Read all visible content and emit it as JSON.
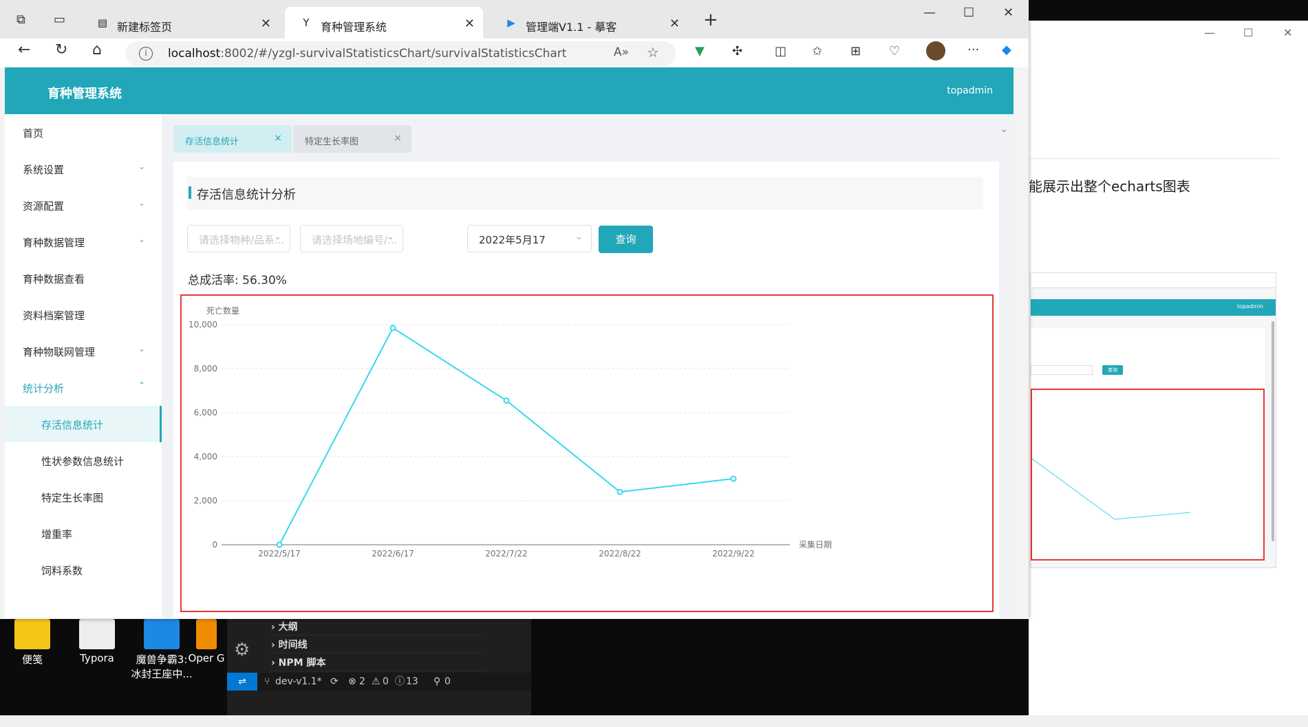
{
  "browser": {
    "tabs": [
      {
        "label": "新建标签页",
        "icon": "new-tab-page-icon"
      },
      {
        "label": "育种管理系统",
        "icon": "y-logo-icon",
        "active": true
      },
      {
        "label": "管理端V1.1 - 摹客",
        "icon": "play-icon"
      }
    ],
    "url_host": "localhost",
    "url_rest": ":8002/#/yzgl-survivalStatisticsChart/survivalStatisticsChart"
  },
  "app": {
    "title": "育种管理系统",
    "user": "topadmin"
  },
  "sidebar": {
    "items": [
      {
        "label": "首页",
        "chev": ""
      },
      {
        "label": "系统设置",
        "chev": "⌄"
      },
      {
        "label": "资源配置",
        "chev": "⌄"
      },
      {
        "label": "育种数据管理",
        "chev": "⌄"
      },
      {
        "label": "育种数据查看",
        "chev": ""
      },
      {
        "label": "资料档案管理",
        "chev": ""
      },
      {
        "label": "育种物联网管理",
        "chev": "⌄"
      },
      {
        "label": "统计分析",
        "chev": "⌃"
      },
      {
        "label": "存活信息统计",
        "chev": ""
      },
      {
        "label": "性状参数信息统计",
        "chev": ""
      },
      {
        "label": "特定生长率图",
        "chev": ""
      },
      {
        "label": "增重率",
        "chev": ""
      },
      {
        "label": "饲料系数",
        "chev": ""
      }
    ]
  },
  "tags": [
    {
      "label": "存活信息统计",
      "close": "×"
    },
    {
      "label": "特定生长率图",
      "close": "×"
    }
  ],
  "card": {
    "title": "存活信息统计分析",
    "filters": {
      "species_placeholder": "请选择物种/品系...",
      "site_placeholder": "请选择场地编号/...",
      "date_value": "2022年5月17"
    },
    "query_label": "查询",
    "rate_label": "总成活率:",
    "rate_value": "56.30%"
  },
  "chart_data": {
    "type": "line",
    "ylabel": "死亡数量",
    "xlabel": "采集日期",
    "categories": [
      "2022/5/17",
      "2022/6/17",
      "2022/7/22",
      "2022/8/22",
      "2022/9/22"
    ],
    "values": [
      0,
      9850,
      6550,
      2400,
      3000
    ],
    "ylim": [
      0,
      10000
    ],
    "yticks": [
      "0",
      "2,000",
      "4,000",
      "6,000",
      "8,000",
      "10,000"
    ],
    "line_color": "#36d8ec",
    "grid": true
  },
  "right_doc": {
    "text": "能展示出整个echarts图表",
    "thumb_user": "topadmin",
    "thumb_btn": "查询"
  },
  "vscode": {
    "rows": [
      "大纲",
      "时间线",
      "NPM 脚本"
    ],
    "branch": "dev-v1.1*",
    "errors": "2",
    "warnings": "0",
    "info": "13",
    "ports": "0"
  },
  "desktop_icons": [
    "便笺",
    "Typora",
    "魔兽争霸3: 冰封王座中...",
    "Oper G"
  ]
}
